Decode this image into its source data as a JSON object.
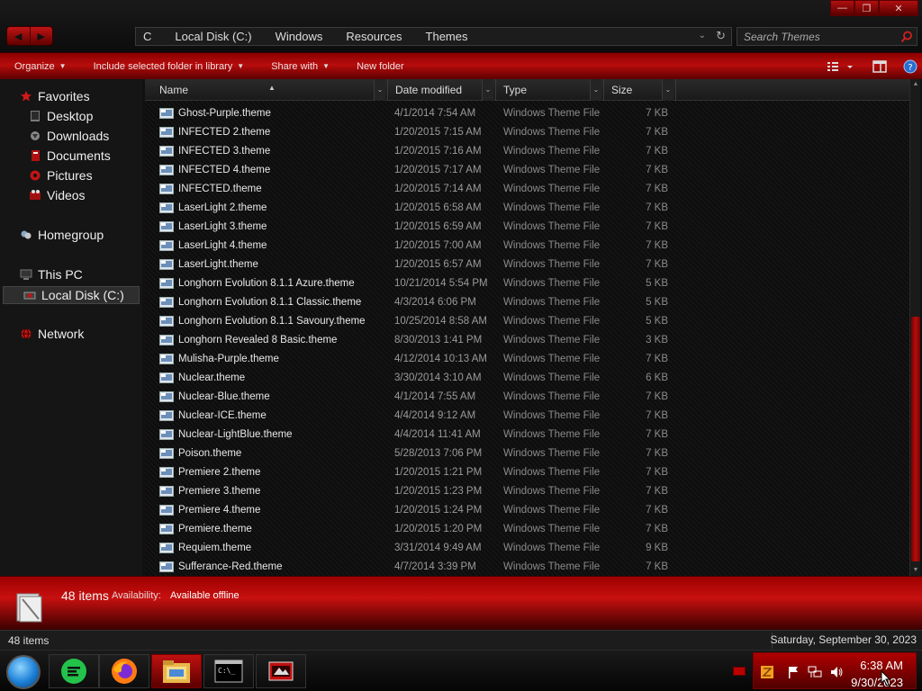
{
  "address": {
    "partial_crumb": "C",
    "crumbs": [
      "Local Disk (C:)",
      "Windows",
      "Resources",
      "Themes"
    ],
    "search_placeholder": "Search Themes"
  },
  "toolbar": {
    "organize": "Organize",
    "include": "Include selected folder in library",
    "share": "Share with",
    "new_folder": "New folder"
  },
  "nav": {
    "favorites": "Favorites",
    "desktop": "Desktop",
    "downloads": "Downloads",
    "documents": "Documents",
    "pictures": "Pictures",
    "videos": "Videos",
    "homegroup": "Homegroup",
    "thispc": "This PC",
    "localdisk": "Local Disk (C:)",
    "network": "Network"
  },
  "columns": {
    "name": "Name",
    "date": "Date modified",
    "type": "Type",
    "size": "Size"
  },
  "files": [
    {
      "name": "Ghost-Purple.theme",
      "date": "4/1/2014 7:54 AM",
      "type": "Windows Theme File",
      "size": "7 KB"
    },
    {
      "name": "INFECTED 2.theme",
      "date": "1/20/2015 7:15 AM",
      "type": "Windows Theme File",
      "size": "7 KB"
    },
    {
      "name": "INFECTED 3.theme",
      "date": "1/20/2015 7:16 AM",
      "type": "Windows Theme File",
      "size": "7 KB"
    },
    {
      "name": "INFECTED 4.theme",
      "date": "1/20/2015 7:17 AM",
      "type": "Windows Theme File",
      "size": "7 KB"
    },
    {
      "name": "INFECTED.theme",
      "date": "1/20/2015 7:14 AM",
      "type": "Windows Theme File",
      "size": "7 KB"
    },
    {
      "name": "LaserLight 2.theme",
      "date": "1/20/2015 6:58 AM",
      "type": "Windows Theme File",
      "size": "7 KB"
    },
    {
      "name": "LaserLight 3.theme",
      "date": "1/20/2015 6:59 AM",
      "type": "Windows Theme File",
      "size": "7 KB"
    },
    {
      "name": "LaserLight 4.theme",
      "date": "1/20/2015 7:00 AM",
      "type": "Windows Theme File",
      "size": "7 KB"
    },
    {
      "name": "LaserLight.theme",
      "date": "1/20/2015 6:57 AM",
      "type": "Windows Theme File",
      "size": "7 KB"
    },
    {
      "name": "Longhorn Evolution 8.1.1 Azure.theme",
      "date": "10/21/2014 5:54 PM",
      "type": "Windows Theme File",
      "size": "5 KB"
    },
    {
      "name": "Longhorn Evolution 8.1.1 Classic.theme",
      "date": "4/3/2014 6:06 PM",
      "type": "Windows Theme File",
      "size": "5 KB"
    },
    {
      "name": "Longhorn Evolution 8.1.1 Savoury.theme",
      "date": "10/25/2014 8:58 AM",
      "type": "Windows Theme File",
      "size": "5 KB"
    },
    {
      "name": "Longhorn Revealed 8 Basic.theme",
      "date": "8/30/2013 1:41 PM",
      "type": "Windows Theme File",
      "size": "3 KB"
    },
    {
      "name": "Mulisha-Purple.theme",
      "date": "4/12/2014 10:13 AM",
      "type": "Windows Theme File",
      "size": "7 KB"
    },
    {
      "name": "Nuclear.theme",
      "date": "3/30/2014 3:10 AM",
      "type": "Windows Theme File",
      "size": "6 KB"
    },
    {
      "name": "Nuclear-Blue.theme",
      "date": "4/1/2014 7:55 AM",
      "type": "Windows Theme File",
      "size": "7 KB"
    },
    {
      "name": "Nuclear-ICE.theme",
      "date": "4/4/2014 9:12 AM",
      "type": "Windows Theme File",
      "size": "7 KB"
    },
    {
      "name": "Nuclear-LightBlue.theme",
      "date": "4/4/2014 11:41 AM",
      "type": "Windows Theme File",
      "size": "7 KB"
    },
    {
      "name": "Poison.theme",
      "date": "5/28/2013 7:06 PM",
      "type": "Windows Theme File",
      "size": "7 KB"
    },
    {
      "name": "Premiere 2.theme",
      "date": "1/20/2015 1:21 PM",
      "type": "Windows Theme File",
      "size": "7 KB"
    },
    {
      "name": "Premiere 3.theme",
      "date": "1/20/2015 1:23 PM",
      "type": "Windows Theme File",
      "size": "7 KB"
    },
    {
      "name": "Premiere 4.theme",
      "date": "1/20/2015 1:24 PM",
      "type": "Windows Theme File",
      "size": "7 KB"
    },
    {
      "name": "Premiere.theme",
      "date": "1/20/2015 1:20 PM",
      "type": "Windows Theme File",
      "size": "7 KB"
    },
    {
      "name": "Requiem.theme",
      "date": "3/31/2014 9:49 AM",
      "type": "Windows Theme File",
      "size": "9 KB"
    },
    {
      "name": "Sufferance-Red.theme",
      "date": "4/7/2014 3:39 PM",
      "type": "Windows Theme File",
      "size": "7 KB"
    }
  ],
  "details": {
    "count": "48 items",
    "availability_label": "Availability:",
    "availability_value": "Available offline"
  },
  "statusbar": {
    "items": "48 items",
    "date": "Saturday, September 30, 2023"
  },
  "taskbar": {
    "time": "6:38 AM",
    "date": "9/30/2023"
  },
  "colors": {
    "accent": "#b80c0c",
    "accent_dark": "#5a0000",
    "background": "#0d0d0d"
  },
  "icons": [
    "back-arrow-icon",
    "forward-arrow-icon",
    "refresh-icon",
    "search-icon",
    "star-icon",
    "folder-icon",
    "computer-icon",
    "network-icon",
    "theme-file-icon",
    "help-icon",
    "firefox-icon",
    "file-explorer-icon",
    "terminal-icon"
  ]
}
